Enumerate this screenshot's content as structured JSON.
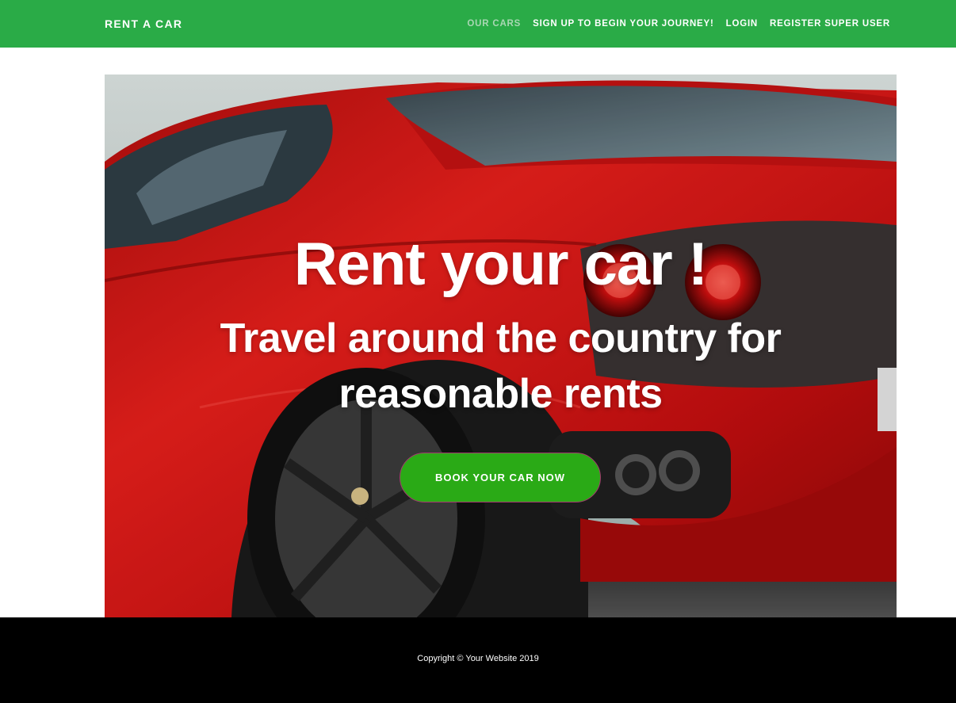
{
  "navbar": {
    "brand": "RENT A CAR",
    "links": [
      {
        "label": "OUR CARS",
        "active": true
      },
      {
        "label": "SIGN UP TO BEGIN YOUR JOURNEY!",
        "active": false
      },
      {
        "label": "LOGIN",
        "active": false
      },
      {
        "label": "REGISTER SUPER USER",
        "active": false
      }
    ]
  },
  "hero": {
    "title": "Rent your car !",
    "subtitle": "Travel around the country for reasonable rents",
    "cta_label": "BOOK YOUR CAR NOW",
    "image": "red-sports-car-photo"
  },
  "footer": {
    "copyright": "Copyright © Your Website 2019"
  },
  "colors": {
    "navbar_bg": "#2aab47",
    "nav_active": "#a9d7b3",
    "cta_bg": "#2aaa16",
    "cta_border": "#a33b6e",
    "footer_bg": "#000000",
    "car_red": "#d01414"
  }
}
